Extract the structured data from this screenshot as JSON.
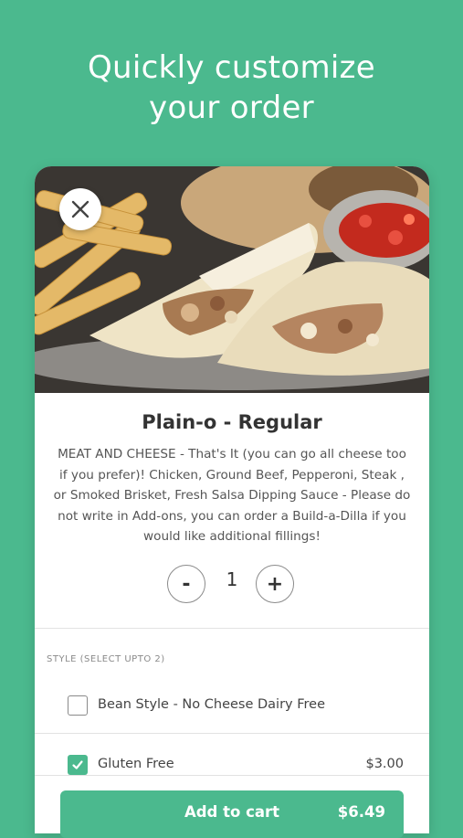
{
  "headline": {
    "line1": "Quickly customize",
    "line2": "your order"
  },
  "item": {
    "name": "Plain-o - Regular",
    "description": "MEAT AND CHEESE - That's It (you can go all cheese too if you prefer)! Chicken, Ground Beef, Pepperoni, Steak , or Smoked Brisket, Fresh Salsa Dipping Sauce - Please do not write in Add-ons, you can order a Build-a-Dilla if you would like additional fillings!"
  },
  "quantity": {
    "minus_label": "-",
    "value": "1",
    "plus_label": "+"
  },
  "options": {
    "section_label": "STYLE (SELECT UPTO 2)",
    "items": [
      {
        "label": "Bean Style - No Cheese Dairy Free",
        "price": "",
        "checked": false
      },
      {
        "label": "Gluten Free",
        "price": "$3.00",
        "checked": true
      }
    ]
  },
  "cart": {
    "button_label": "Add to cart",
    "total": "$6.49"
  },
  "colors": {
    "brand": "#4bb98e"
  },
  "icons": {
    "close": "close-icon",
    "check": "checkmark-icon"
  }
}
